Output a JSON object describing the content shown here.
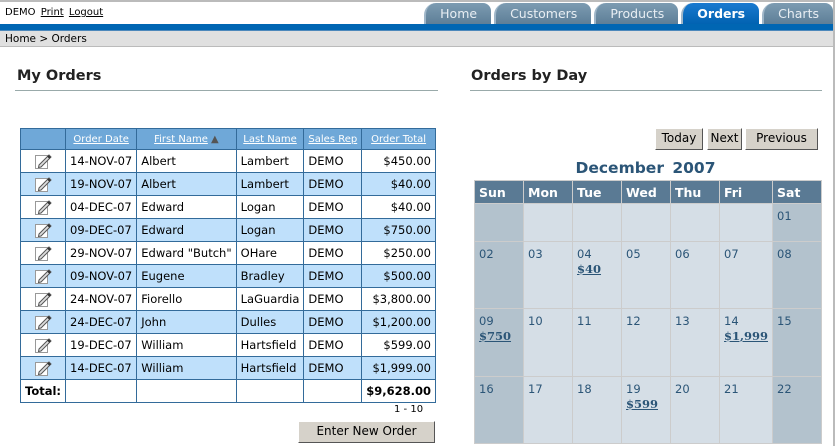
{
  "header": {
    "user": "DEMO",
    "print": "Print",
    "logout": "Logout"
  },
  "tabs": [
    {
      "label": "Home"
    },
    {
      "label": "Customers"
    },
    {
      "label": "Products"
    },
    {
      "label": "Orders",
      "active": true
    },
    {
      "label": "Charts"
    }
  ],
  "breadcrumb": "Home > Orders",
  "orders": {
    "title": "My Orders",
    "columns": [
      "Order Date",
      "First Name",
      "Last Name",
      "Sales Rep",
      "Order Total"
    ],
    "rows": [
      [
        "14-NOV-07",
        "Albert",
        "Lambert",
        "DEMO",
        "$450.00"
      ],
      [
        "19-NOV-07",
        "Albert",
        "Lambert",
        "DEMO",
        "$40.00"
      ],
      [
        "04-DEC-07",
        "Edward",
        "Logan",
        "DEMO",
        "$40.00"
      ],
      [
        "09-DEC-07",
        "Edward",
        "Logan",
        "DEMO",
        "$750.00"
      ],
      [
        "29-NOV-07",
        "Edward \"Butch\"",
        "OHare",
        "DEMO",
        "$250.00"
      ],
      [
        "09-NOV-07",
        "Eugene",
        "Bradley",
        "DEMO",
        "$500.00"
      ],
      [
        "24-NOV-07",
        "Fiorello",
        "LaGuardia",
        "DEMO",
        "$3,800.00"
      ],
      [
        "24-DEC-07",
        "John",
        "Dulles",
        "DEMO",
        "$1,200.00"
      ],
      [
        "19-DEC-07",
        "William",
        "Hartsfield",
        "DEMO",
        "$599.00"
      ],
      [
        "14-DEC-07",
        "William",
        "Hartsfield",
        "DEMO",
        "$1,999.00"
      ]
    ],
    "total_label": "Total:",
    "total": "$9,628.00",
    "pager": "1 - 10",
    "enter_button": "Enter New Order"
  },
  "calendar": {
    "title": "Orders by Day",
    "month": "December  2007",
    "buttons": {
      "today": "Today",
      "next": "Next",
      "previous": "Previous"
    },
    "weekdays": [
      "Sun",
      "Mon",
      "Tue",
      "Wed",
      "Thu",
      "Fri",
      "Sat"
    ],
    "weeks": [
      [
        null,
        null,
        null,
        null,
        null,
        null,
        {
          "d": "01"
        }
      ],
      [
        {
          "d": "02"
        },
        {
          "d": "03"
        },
        {
          "d": "04",
          "amt": "$40"
        },
        {
          "d": "05"
        },
        {
          "d": "06"
        },
        {
          "d": "07"
        },
        {
          "d": "08"
        }
      ],
      [
        {
          "d": "09",
          "amt": "$750"
        },
        {
          "d": "10"
        },
        {
          "d": "11"
        },
        {
          "d": "12"
        },
        {
          "d": "13"
        },
        {
          "d": "14",
          "amt": "$1,999"
        },
        {
          "d": "15"
        }
      ],
      [
        {
          "d": "16"
        },
        {
          "d": "17"
        },
        {
          "d": "18"
        },
        {
          "d": "19",
          "amt": "$599"
        },
        {
          "d": "20"
        },
        {
          "d": "21"
        },
        {
          "d": "22"
        }
      ]
    ]
  }
}
